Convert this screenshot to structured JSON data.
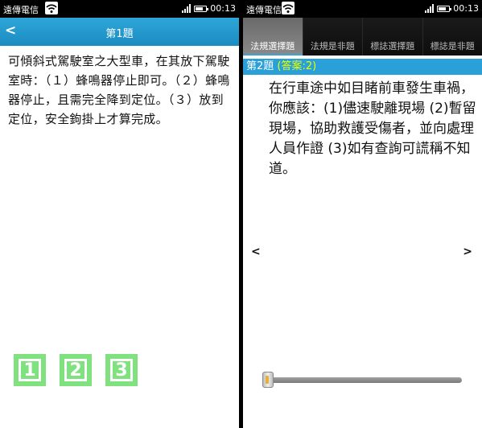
{
  "left": {
    "status": {
      "carrier": "遠傳電信",
      "time": "00:13"
    },
    "header": {
      "back": "<",
      "title": "第1題"
    },
    "question": "可傾斜式駕駛室之大型車，在其放下駕駛室時：（１）蜂鳴器停止即可。（２）蜂鳴器停止，且需完全降到定位。（３）放到定位，安全鉤掛上才算完成。",
    "answers": [
      "1",
      "2",
      "3"
    ]
  },
  "right": {
    "status": {
      "carrier": "遠傳電信",
      "time": "00:13"
    },
    "tabs": [
      "法規選擇題",
      "法規是非題",
      "標誌選擇題",
      "標誌是非題"
    ],
    "question_header": {
      "number": "第2題",
      "answer": "(答案:2)"
    },
    "question": "在行車途中如目睹前車發生車禍，你應該：(1)儘速駛離現場 (2)暫留現場，協助救護受傷者，並向處理人員作證 (3)如有查詢可謊稱不知道。",
    "nav": {
      "prev": "<",
      "next": ">"
    },
    "slider_value": 0
  }
}
